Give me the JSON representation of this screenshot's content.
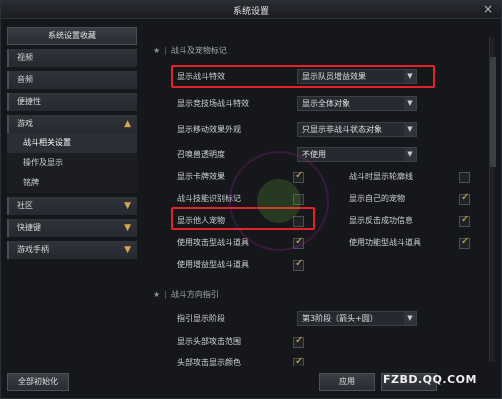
{
  "window": {
    "title": "系统设置",
    "close_icon": "×"
  },
  "sidebar": {
    "header": "系统设置收藏",
    "items": [
      {
        "label": "视频"
      },
      {
        "label": "音频"
      },
      {
        "label": "便捷性"
      },
      {
        "label": "游戏",
        "expanded": true
      },
      {
        "label": "社区"
      },
      {
        "label": "快捷键"
      },
      {
        "label": "游戏手柄"
      }
    ],
    "sub_items": [
      {
        "label": "战斗相关设置",
        "active": true
      },
      {
        "label": "操作及显示"
      },
      {
        "label": "铭牌"
      }
    ],
    "reset_button": "全部初始化"
  },
  "sections": {
    "combat_pet": "战斗及宠物标记",
    "direction": "战斗方向指引"
  },
  "settings": {
    "show_combat_effect": {
      "label": "显示战斗特效",
      "value": "显示队员增益效果"
    },
    "show_arena_effect": {
      "label": "显示竞技场战斗特效",
      "value": "显示全体对象"
    },
    "show_move_effect": {
      "label": "显示移动效果外观",
      "value": "只显示非战斗状态对象"
    },
    "summon_transparency": {
      "label": "召唤兽透明度",
      "value": "不使用"
    },
    "show_card_effect": {
      "label": "显示卡牌效果",
      "checked": true
    },
    "combat_outline": {
      "label": "战斗时显示轮廓线",
      "checked": false
    },
    "skill_mark": {
      "label": "战斗技能识别标记",
      "checked": false
    },
    "show_own_pet": {
      "label": "显示自己的宠物",
      "checked": true
    },
    "show_others_pet": {
      "label": "显示他人宠物",
      "checked": false
    },
    "show_counter": {
      "label": "显示反击成功信息",
      "checked": true
    },
    "attack_item": {
      "label": "使用攻击型战斗道具",
      "checked": true
    },
    "func_item": {
      "label": "使用功能型战斗道具",
      "checked": true
    },
    "buff_item": {
      "label": "使用增益型战斗道具",
      "checked": true
    },
    "guide_stage": {
      "label": "指引显示阶段",
      "value": "第3阶段（箭头+圆）"
    },
    "head_attack_range": {
      "label": "显示头部攻击范围",
      "checked": true
    },
    "head_attack_color": {
      "label": "头部攻击显示颜色",
      "checked": true
    }
  },
  "footer": {
    "apply": "应用",
    "watermark": "FZBD.QQ.COM"
  },
  "colors": {
    "accent": "#e7b64a",
    "highlight": "#e2232a"
  }
}
